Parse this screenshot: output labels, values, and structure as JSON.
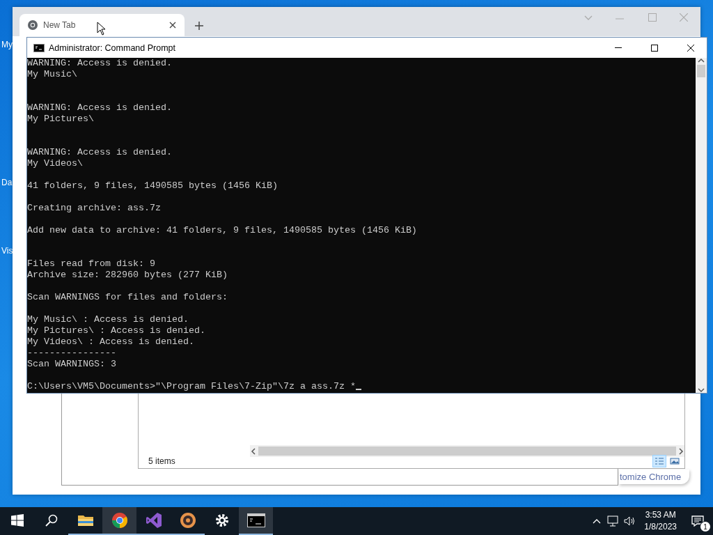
{
  "desktop": {
    "icons": [
      {
        "label": "My"
      },
      {
        "label": "Da"
      },
      {
        "label": "Vis"
      }
    ]
  },
  "browser": {
    "tabs": [
      {
        "title": "New Tab",
        "selected": true
      }
    ],
    "customize_button": "tomize Chrome"
  },
  "explorer": {
    "status": "5 items",
    "views": [
      {
        "kind": "details",
        "selected": true
      },
      {
        "kind": "tiles",
        "selected": false
      }
    ]
  },
  "console": {
    "title": "Administrator:  Command Prompt",
    "lines": [
      {
        "kind": "text",
        "text": "WARNING: Access is denied."
      },
      {
        "kind": "text",
        "text": "My Music\\"
      },
      {
        "kind": "blank"
      },
      {
        "kind": "blank"
      },
      {
        "kind": "text",
        "text": "WARNING: Access is denied."
      },
      {
        "kind": "text",
        "text": "My Pictures\\"
      },
      {
        "kind": "blank"
      },
      {
        "kind": "blank"
      },
      {
        "kind": "text",
        "text": "WARNING: Access is denied."
      },
      {
        "kind": "text",
        "text": "My Videos\\"
      },
      {
        "kind": "blank"
      },
      {
        "kind": "text",
        "text": "41 folders, 9 files, 1490585 bytes (1456 KiB)"
      },
      {
        "kind": "blank"
      },
      {
        "kind": "text",
        "text": "Creating archive: ass.7z"
      },
      {
        "kind": "blank"
      },
      {
        "kind": "text",
        "text": "Add new data to archive: 41 folders, 9 files, 1490585 bytes (1456 KiB)"
      },
      {
        "kind": "blank"
      },
      {
        "kind": "blank"
      },
      {
        "kind": "text",
        "text": "Files read from disk: 9"
      },
      {
        "kind": "text",
        "text": "Archive size: 282960 bytes (277 KiB)"
      },
      {
        "kind": "blank"
      },
      {
        "kind": "text",
        "text": "Scan WARNINGS for files and folders:"
      },
      {
        "kind": "blank"
      },
      {
        "kind": "text",
        "text": "My Music\\ : Access is denied."
      },
      {
        "kind": "text",
        "text": "My Pictures\\ : Access is denied."
      },
      {
        "kind": "text",
        "text": "My Videos\\ : Access is denied."
      },
      {
        "kind": "text",
        "text": "----------------"
      },
      {
        "kind": "text",
        "text": "Scan WARNINGS: 3"
      },
      {
        "kind": "blank"
      },
      {
        "kind": "input",
        "text": "C:\\Users\\VM5\\Documents>\"\\Program Files\\7-Zip\"\\7z a ass.7z *"
      }
    ]
  },
  "taskbar": {
    "apps": [
      {
        "kind": "start",
        "running": false,
        "active": false
      },
      {
        "kind": "search",
        "running": false,
        "active": false
      },
      {
        "kind": "explorer",
        "running": true,
        "active": false
      },
      {
        "kind": "chrome",
        "running": true,
        "active": true
      },
      {
        "kind": "studio",
        "running": true,
        "active": false
      },
      {
        "kind": "disc",
        "running": true,
        "active": false
      },
      {
        "kind": "settings",
        "running": false,
        "active": false
      },
      {
        "kind": "terminal",
        "running": true,
        "active": true
      }
    ],
    "clock": {
      "time": "3:53 AM",
      "date": "1/8/2023"
    },
    "notifications": {
      "count": "1"
    }
  }
}
